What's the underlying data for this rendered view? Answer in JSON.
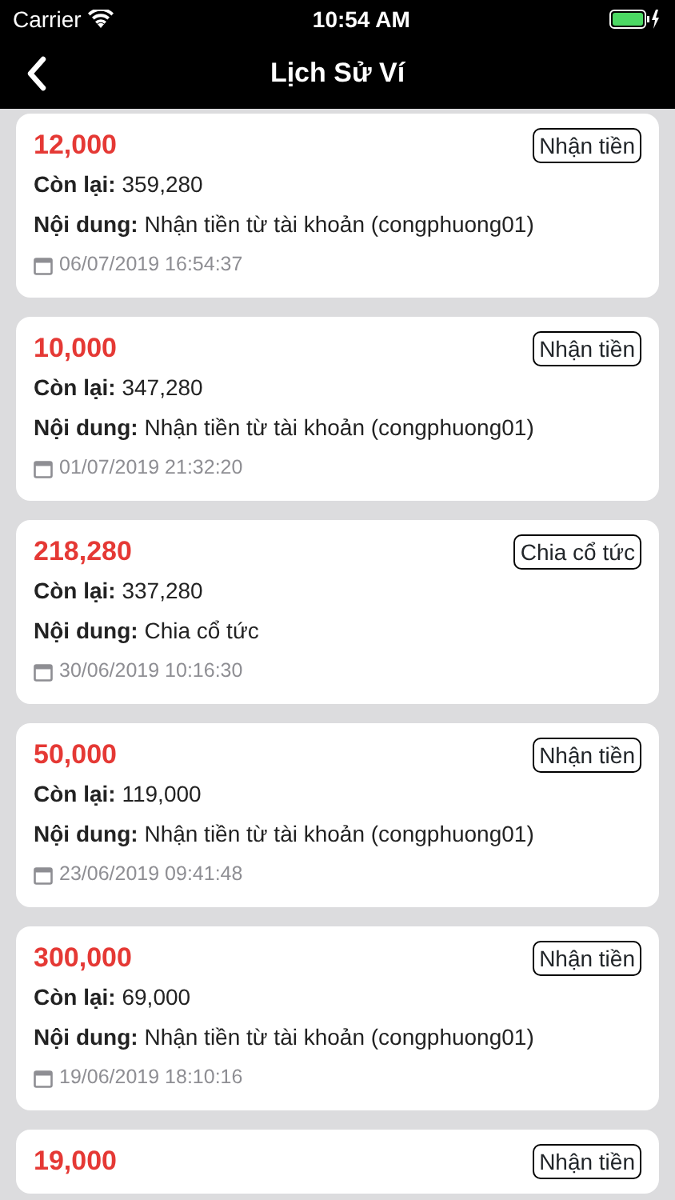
{
  "status_bar": {
    "carrier": "Carrier",
    "time": "10:54 AM"
  },
  "header": {
    "title": "Lịch Sử Ví"
  },
  "transactions": [
    {
      "amount": "12,000",
      "type": "Nhận tiền",
      "balance": "**Còn lại:** 359,280",
      "content": "**Nội dung:** Nhận tiền từ tài khoản (congphuong01)",
      "date": "06/07/2019 16:54:37"
    },
    {
      "amount": "10,000",
      "type": "Nhận tiền",
      "balance": "**Còn lại:** 347,280",
      "content": "**Nội dung:** Nhận tiền từ tài khoản (congphuong01)",
      "date": "01/07/2019 21:32:20"
    },
    {
      "amount": "218,280",
      "type": "Chia cổ tức",
      "balance": "**Còn lại:** 337,280",
      "content": "**Nội dung:** Chia cổ tức",
      "date": "30/06/2019 10:16:30"
    },
    {
      "amount": "50,000",
      "type": "Nhận tiền",
      "balance": "**Còn lại:** 119,000",
      "content": "**Nội dung:** Nhận tiền từ tài khoản (congphuong01)",
      "date": "23/06/2019 09:41:48"
    },
    {
      "amount": "300,000",
      "type": "Nhận tiền",
      "balance": "**Còn lại:** 69,000",
      "content": "**Nội dung:** Nhận tiền từ tài khoản (congphuong01)",
      "date": "19/06/2019 18:10:16"
    },
    {
      "amount": "19,000",
      "type": "Nhận tiền"
    }
  ]
}
